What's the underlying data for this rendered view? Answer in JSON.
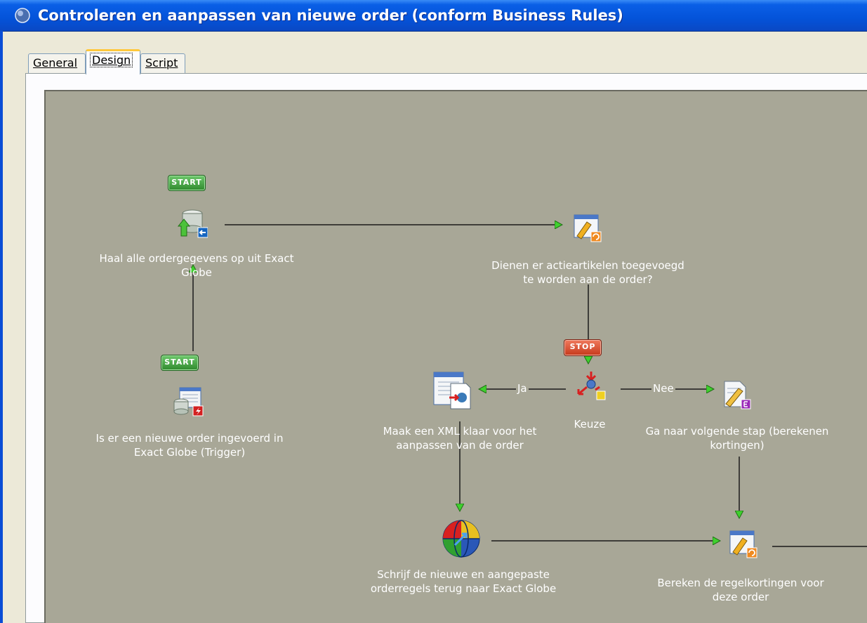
{
  "window": {
    "title": "Controleren en aanpassen van nieuwe order (conform Business Rules)"
  },
  "tabs": [
    {
      "label": "General",
      "active": false
    },
    {
      "label": "Design",
      "active": true
    },
    {
      "label": "Script",
      "active": false
    }
  ],
  "diagram": {
    "badges": {
      "start": "START",
      "stop": "STOP"
    },
    "nodes": {
      "trigger": {
        "label_line1": "Is er een nieuwe order ingevoerd in",
        "label_line2": "Exact Globe (Trigger)",
        "icon": "database-trigger-icon"
      },
      "fetch": {
        "label_line1": "Haal alle ordergegevens op uit Exact",
        "label_line2": "Globe",
        "icon": "database-import-icon"
      },
      "question": {
        "label_line1": "Dienen er actieartikelen toegevoegd",
        "label_line2": "te worden aan de order?",
        "icon": "script-task-icon"
      },
      "choice": {
        "label_line1": "Keuze",
        "label_line2": "",
        "icon": "decision-icon"
      },
      "xml": {
        "label_line1": "Maak een XML klaar voor het",
        "label_line2": "aanpassen van de order",
        "icon": "xml-document-icon"
      },
      "next": {
        "label_line1": "Ga naar volgende stap (berekenen",
        "label_line2": "kortingen)",
        "icon": "edit-task-icon"
      },
      "write": {
        "label_line1": "Schrijf de nieuwe en aangepaste",
        "label_line2": "orderregels terug naar Exact Globe",
        "icon": "web-service-globe-icon"
      },
      "discount": {
        "label_line1": "Bereken de regelkortingen voor",
        "label_line2": "deze order",
        "icon": "script-task-icon"
      }
    },
    "edges": {
      "yes": "Ja",
      "no": "Nee"
    }
  }
}
